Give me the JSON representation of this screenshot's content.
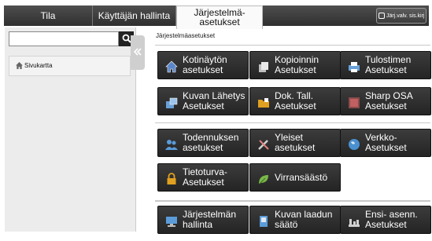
{
  "tabs": [
    {
      "label": "Tila"
    },
    {
      "label": "Käyttäjän hallinta"
    },
    {
      "label": "Järjestelmä-\nasetukset"
    }
  ],
  "header": {
    "logout_label": "Järj.valv. sis.kirj"
  },
  "sidebar": {
    "search": {
      "value": "",
      "placeholder": ""
    },
    "items": [
      {
        "label": "Sivukartta"
      }
    ]
  },
  "main": {
    "breadcrumb": "Järjestelmäasetukset",
    "tiles": [
      {
        "label": "Kotinäytön\nasetukset",
        "icon": "home-icon",
        "color": "#5a86c9"
      },
      {
        "label": "Kopioinnin\nAsetukset",
        "icon": "copy-icon",
        "color": "#d9d9d9"
      },
      {
        "label": "Tulostimen\nAsetukset",
        "icon": "printer-icon",
        "color": "#6aa0d8"
      },
      {
        "label": "Kuvan Lähetys\nAsetukset",
        "icon": "image-send-icon",
        "color": "#6aa0d8"
      },
      {
        "label": "Dok. Tall.\nAsetukset",
        "icon": "folder-icon",
        "color": "#e0a020"
      },
      {
        "label": "Sharp OSA\nAsetukset",
        "icon": "sharp-osa-icon",
        "color": "#c06060"
      },
      {
        "label": "Todennuksen\nasetukset",
        "icon": "users-icon",
        "color": "#5a9bd8"
      },
      {
        "label": "Yleiset\nasetukset",
        "icon": "tools-icon",
        "color": "#d0d0d0"
      },
      {
        "label": "Verkko-\nAsetukset",
        "icon": "globe-icon",
        "color": "#4a90d0"
      },
      {
        "label": "Tietoturva-\nAsetukset",
        "icon": "lock-icon",
        "color": "#e0a020"
      },
      {
        "label": "Virransäästö",
        "icon": "leaf-icon",
        "color": "#7ab84a"
      },
      {
        "label": "Järjestelmän\nhallinta",
        "icon": "monitor-icon",
        "color": "#5a9bd8"
      },
      {
        "label": "Kuvan laadun\nsäätö",
        "icon": "image-quality-icon",
        "color": "#5a9bd8"
      },
      {
        "label": "Ensi- asenn.\nAsetukset",
        "icon": "setup-icon",
        "color": "#d0d0d0"
      }
    ]
  }
}
